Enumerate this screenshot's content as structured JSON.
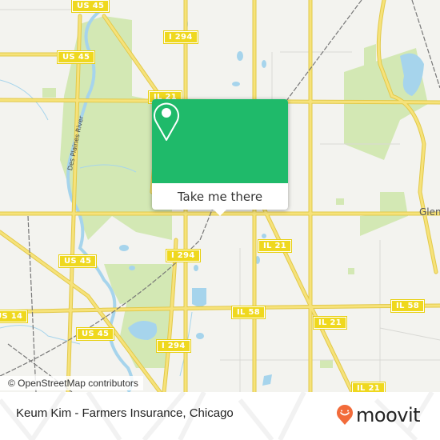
{
  "map": {
    "colors": {
      "background": "#f3f3ef",
      "park": "#d3e8b4",
      "water": "#a6d4ec",
      "road": "#f6e27a",
      "road_outline": "#e2c94a",
      "rail": "#777777",
      "shield": "#efd81e"
    },
    "shields": [
      {
        "label": "US 45"
      },
      {
        "label": "US 45"
      },
      {
        "label": "I 294"
      },
      {
        "label": "IL 21"
      },
      {
        "label": "US 45"
      },
      {
        "label": "I 294"
      },
      {
        "label": "IL 21"
      },
      {
        "label": "US 45"
      },
      {
        "label": "I 294"
      },
      {
        "label": "IL 58"
      },
      {
        "label": "IL 58"
      },
      {
        "label": "IL 21"
      },
      {
        "label": "US 14"
      },
      {
        "label": "IL 21"
      }
    ],
    "place_label": "Glen",
    "river_label": "Des Plaines River",
    "attribution": "© OpenStreetMap contributors"
  },
  "popup": {
    "icon": "map-pin-icon",
    "button_label": "Take me there",
    "accent": "#1fba6a"
  },
  "footer": {
    "title": "Keum Kim - Farmers Insurance, Chicago",
    "logo_text": "moovit",
    "logo_icon": "moovit-pin-smile-icon",
    "logo_color": "#f26b3a"
  }
}
